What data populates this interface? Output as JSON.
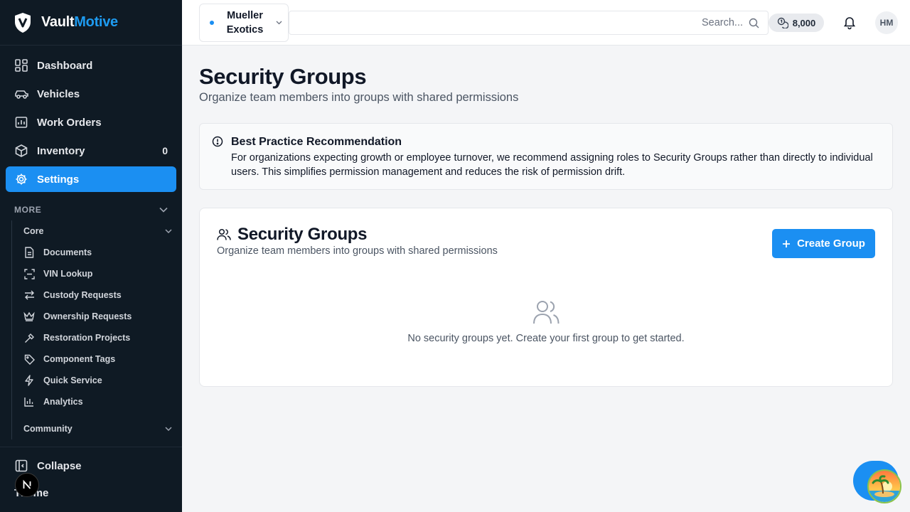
{
  "brand": {
    "name_part1": "Vault",
    "name_part2": "Motive",
    "accent": "#1e9bf0"
  },
  "sidebar": {
    "items": [
      {
        "label": "Dashboard",
        "icon": "dashboard-icon"
      },
      {
        "label": "Vehicles",
        "icon": "car-icon"
      },
      {
        "label": "Work Orders",
        "icon": "clipboard-icon"
      },
      {
        "label": "Inventory",
        "icon": "box-icon",
        "count": "0"
      },
      {
        "label": "Settings",
        "icon": "gear-icon",
        "active": true
      }
    ],
    "more_label": "MORE",
    "core_label": "Core",
    "core_items": [
      {
        "label": "Documents",
        "icon": "document-icon"
      },
      {
        "label": "VIN Lookup",
        "icon": "scan-icon"
      },
      {
        "label": "Custody Requests",
        "icon": "swap-icon"
      },
      {
        "label": "Ownership Requests",
        "icon": "crown-icon"
      },
      {
        "label": "Restoration Projects",
        "icon": "hammer-icon"
      },
      {
        "label": "Component Tags",
        "icon": "tag-icon"
      },
      {
        "label": "Quick Service",
        "icon": "zap-icon"
      },
      {
        "label": "Analytics",
        "icon": "bar-chart-icon"
      }
    ],
    "community_label": "Community",
    "collapse_label": "Collapse",
    "theme_label": "Theme"
  },
  "topbar": {
    "org_name": "Mueller Exotics",
    "search_placeholder": "Search...",
    "credits": "8,000",
    "avatar_initials": "HM"
  },
  "page": {
    "title": "Security Groups",
    "subtitle": "Organize team members into groups with shared permissions"
  },
  "alert": {
    "title": "Best Practice Recommendation",
    "body": "For organizations expecting growth or employee turnover, we recommend assigning roles to Security Groups rather than directly to individual users. This simplifies permission management and reduces the risk of permission drift."
  },
  "card": {
    "title": "Security Groups",
    "subtitle": "Organize team members into groups with shared permissions",
    "create_button": "Create Group",
    "empty_text": "No security groups yet. Create your first group to get started."
  },
  "colors": {
    "primary": "#1b8ff2",
    "sidebar_bg": "#0f1a24"
  }
}
